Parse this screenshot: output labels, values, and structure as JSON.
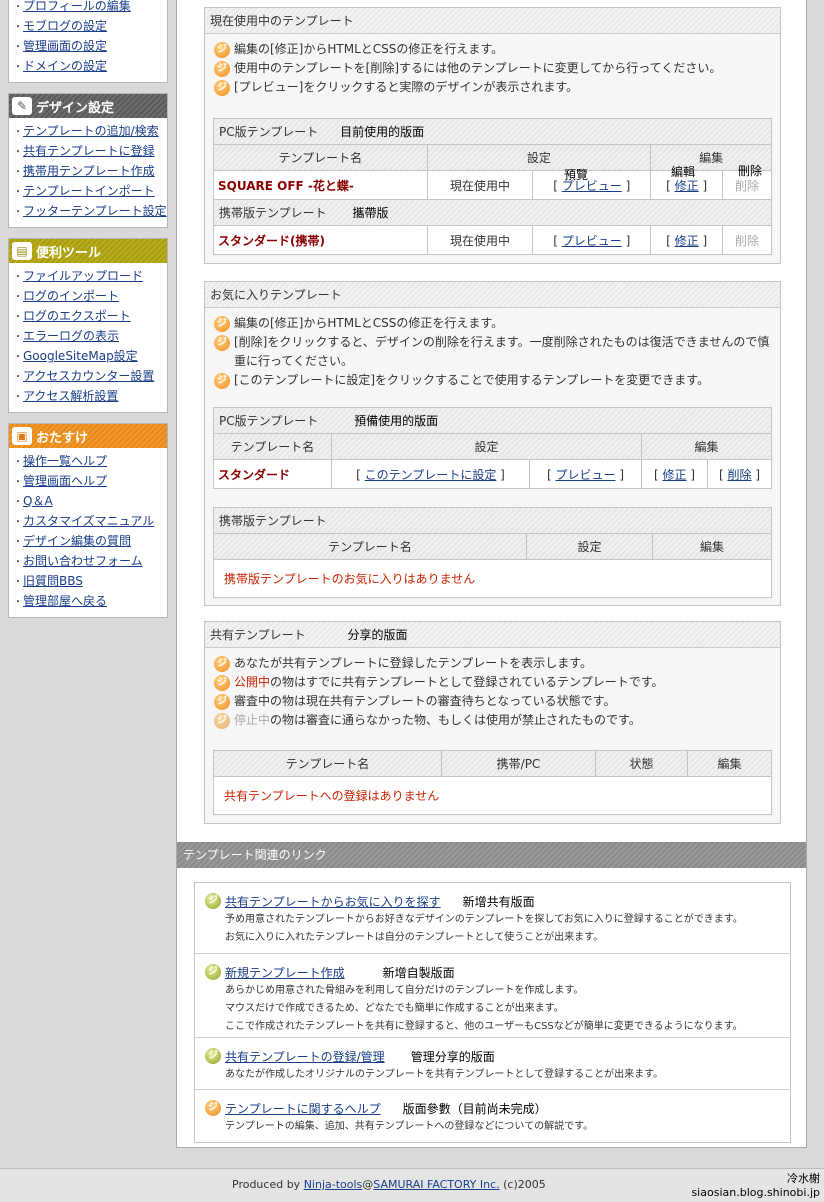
{
  "sidebar": {
    "top_items": [
      "プロフィールの編集",
      "モブログの設定",
      "管理画面の設定",
      "ドメインの設定"
    ],
    "design": {
      "title": "デザイン設定",
      "items": [
        "テンプレートの追加/検索",
        "共有テンプレートに登録",
        "携帯用テンプレート作成",
        "テンプレートインポート",
        "フッターテンプレート設定"
      ]
    },
    "tools": {
      "title": "便利ツール",
      "items": [
        "ファイルアップロード",
        "ログのインポート",
        "ログのエクスポート",
        "エラーログの表示",
        "GoogleSiteMap設定",
        "アクセスカウンター設置",
        "アクセス解析設置"
      ]
    },
    "osusume": {
      "title": "おたすけ",
      "items": [
        "操作一覧ヘルプ",
        "管理画面ヘルプ",
        "Q＆A",
        "カスタマイズマニュアル",
        "デザイン編集の質問",
        "お問い合わせフォーム",
        "旧質問BBS",
        "管理部屋へ戻る"
      ]
    }
  },
  "current": {
    "title": "現在使用中のテンプレート",
    "notes": [
      "編集の[修正]からHTMLとCSSの修正を行えます。",
      "使用中のテンプレートを[削除]するには他のテンプレートに変更してから行ってください。",
      "[プレビュー]をクリックすると実際のデザインが表示されます。"
    ],
    "pc_label": "PC版テンプレート",
    "pc_annot": "目前使用的版面",
    "col_name": "テンプレート名",
    "col_setting": "設定",
    "col_edit": "編集",
    "annot_preview": "預覽",
    "annot_edit": "編輯",
    "annot_delete": "刪除",
    "pc_row": {
      "name": "SQUARE OFF -花と蝶-",
      "status": "現在使用中",
      "preview": "プレビュー",
      "edit": "修正",
      "delete": "削除"
    },
    "mobile_label": "携帯版テンプレート",
    "mobile_annot": "攜帶版",
    "mobile_row": {
      "name": "スタンダード(携帯)",
      "status": "現在使用中",
      "preview": "プレビュー",
      "edit": "修正",
      "delete": "削除"
    }
  },
  "favorites": {
    "title": "お気に入りテンプレート",
    "notes": [
      "編集の[修正]からHTMLとCSSの修正を行えます。",
      "[削除]をクリックすると、デザインの削除を行えます。一度削除されたものは復活できませんので慎重に行ってください。",
      "[このテンプレートに設定]をクリックすることで使用するテンプレートを変更できます。"
    ],
    "pc_label": "PC版テンプレート",
    "pc_annot": "預備使用的版面",
    "col_name": "テンプレート名",
    "col_setting": "設定",
    "col_edit": "編集",
    "pc_row": {
      "name": "スタンダード",
      "set": "このテンプレートに設定",
      "preview": "プレビュー",
      "edit": "修正",
      "delete": "削除"
    },
    "mobile_label": "携帯版テンプレート",
    "mobile_empty": "携帯版テンプレートのお気に入りはありません"
  },
  "shared": {
    "title": "共有テンプレート",
    "annot": "分享的版面",
    "notes": [
      "あなたが共有テンプレートに登録したテンプレートを表示します。",
      "の物はすでに共有テンプレートとして登録されているテンプレートです。",
      "審査中の物は現在共有テンプレートの審査待ちとなっている状態です。",
      "の物は審査に通らなかった物、もしくは使用が禁止されたものです。"
    ],
    "public_word": "公開中",
    "stopped_word": "停止中",
    "col_name": "テンプレート名",
    "col_type": "携帯/PC",
    "col_state": "状態",
    "col_edit": "編集",
    "empty": "共有テンプレートへの登録はありません"
  },
  "links": {
    "title": "テンプレート関連のリンク",
    "items": [
      {
        "link": "共有テンプレートからお気に入りを探す",
        "annot": "新增共有版面",
        "desc": [
          "予め用意されたテンプレートからお好きなデザインのテンプレートを探してお気に入りに登録することができます。",
          "お気に入りに入れたテンプレートは自分のテンプレートとして使うことが出来ます。"
        ]
      },
      {
        "link": "新規テンプレート作成",
        "annot": "新增自製版面",
        "desc": [
          "あらかじめ用意された骨組みを利用して自分だけのテンプレートを作成します。",
          "マウスだけで作成できるため、どなたでも簡単に作成することが出来ます。",
          "ここで作成されたテンプレートを共有に登録すると、他のユーザーもCSSなどが簡単に変更できるようになります。"
        ]
      },
      {
        "link": "共有テンプレートの登録/管理",
        "annot": "管理分享的版面",
        "desc": [
          "あなたが作成したオリジナルのテンプレートを共有テンプレートとして登録することが出来ます。"
        ]
      },
      {
        "link": "テンプレートに関するヘルプ",
        "annot": "版面參數（目前尚未完成）",
        "desc": [
          "テンプレートの編集、追加、共有テンプレートへの登録などについての解説です。"
        ]
      }
    ]
  },
  "footer": {
    "produced_by": "Produced by",
    "ninja": "Ninja-tools",
    "at": "@",
    "samurai": "SAMURAI FACTORY Inc.",
    "copy": "(c)2005"
  },
  "watermark": {
    "line1": "冷水榭",
    "line2": "siaosian.blog.shinobi.jp"
  },
  "colors": {
    "design_head": "#666666",
    "tools_head": "#b0a418",
    "osusume_head": "#f0952a",
    "template_name": "#8b0000",
    "alert": "#cc2200"
  }
}
